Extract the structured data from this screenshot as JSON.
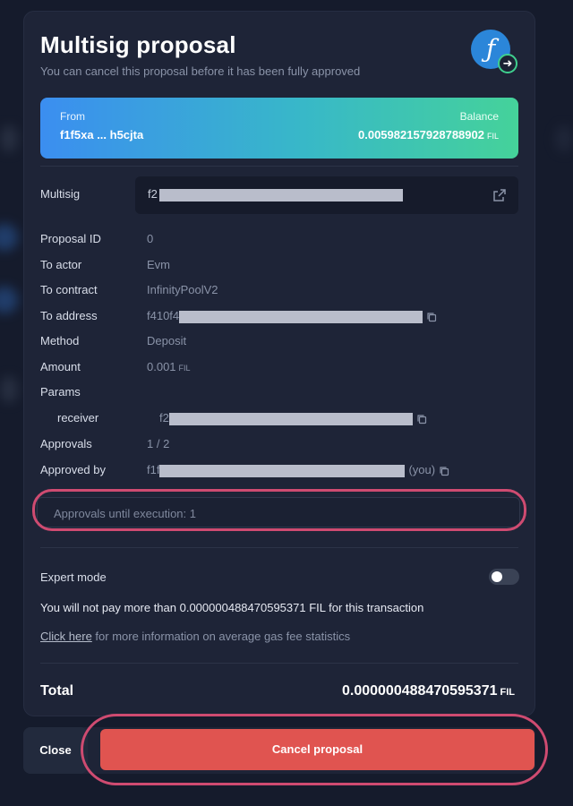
{
  "title": "Multisig proposal",
  "subtitle": "You can cancel this proposal before it has been fully approved",
  "logo_icon": "filecoin-icon",
  "from_card": {
    "from_label": "From",
    "from_value": "f1f5xa ... h5cjta",
    "balance_label": "Balance",
    "balance_value": "0.005982157928788902",
    "balance_unit": "FIL"
  },
  "multisig": {
    "label": "Multisig",
    "value_prefix": "f2"
  },
  "rows": {
    "proposal_id": {
      "label": "Proposal ID",
      "value": "0"
    },
    "to_actor": {
      "label": "To actor",
      "value": "Evm"
    },
    "to_contract": {
      "label": "To contract",
      "value": "InfinityPoolV2"
    },
    "to_address": {
      "label": "To address",
      "value_prefix": "f410f4"
    },
    "method": {
      "label": "Method",
      "value": "Deposit"
    },
    "amount": {
      "label": "Amount",
      "value": "0.001",
      "unit": "FIL"
    },
    "params": {
      "label": "Params"
    },
    "receiver": {
      "label": "receiver",
      "value_prefix": "f2"
    },
    "approvals": {
      "label": "Approvals",
      "value": "1 / 2"
    },
    "approved_by": {
      "label": "Approved by",
      "value_prefix": "f1f",
      "suffix": "(you)"
    }
  },
  "approvals_until": "Approvals until execution: 1",
  "expert_mode": {
    "label": "Expert mode",
    "enabled": false
  },
  "pay_notice": "You will not pay more than 0.000000488470595371 FIL for this transaction",
  "gas_link": "Click here",
  "gas_text": " for more information on average gas fee statistics",
  "total": {
    "label": "Total",
    "value": "0.000000488470595371",
    "unit": "FIL"
  },
  "buttons": {
    "close": "Close",
    "cancel": "Cancel proposal"
  },
  "colors": {
    "accent_red": "#e05450",
    "highlight": "#cf4b71",
    "toggle_off": "#3a4255"
  }
}
